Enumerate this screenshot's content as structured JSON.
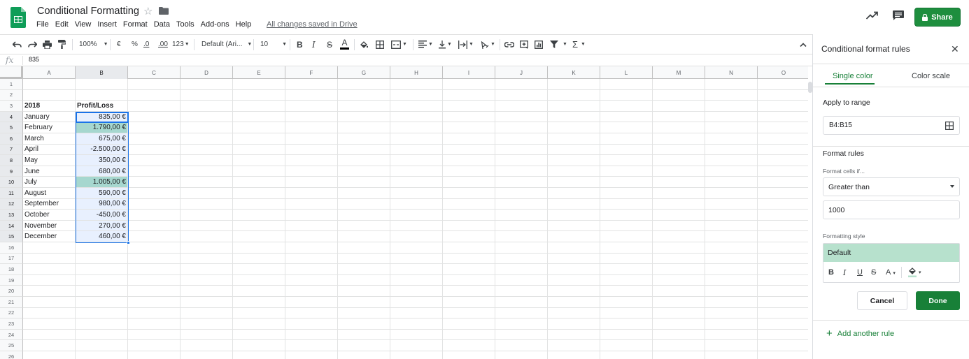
{
  "header": {
    "title": "Conditional Formatting",
    "saved_status": "All changes saved in Drive",
    "share_label": "Share",
    "menu": [
      "File",
      "Edit",
      "View",
      "Insert",
      "Format",
      "Data",
      "Tools",
      "Add-ons",
      "Help"
    ]
  },
  "toolbar": {
    "zoom": "100%",
    "currency": "€",
    "percent": "%",
    "dec_decrease": ".0",
    "dec_increase": ".00",
    "more_formats": "123",
    "font": "Default (Ari...",
    "font_size": "10",
    "bold": "B",
    "italic": "I",
    "strike": "S",
    "text_color": "A",
    "sum": "Σ"
  },
  "formula_bar": {
    "fx_label": "fx",
    "value": "835"
  },
  "grid": {
    "columns": [
      "A",
      "B",
      "C",
      "D",
      "E",
      "F",
      "G",
      "H",
      "I",
      "J",
      "K",
      "L",
      "M",
      "N",
      "O"
    ],
    "selected_column": "B",
    "row_count": 26,
    "cells": [
      {
        "row": 3,
        "col": "A",
        "text": "2018",
        "bold": true
      },
      {
        "row": 3,
        "col": "B",
        "text": "Profit/Loss",
        "bold": true
      },
      {
        "row": 4,
        "col": "A",
        "text": "January"
      },
      {
        "row": 4,
        "col": "B",
        "text": "835,00 €",
        "num": true
      },
      {
        "row": 5,
        "col": "A",
        "text": "February"
      },
      {
        "row": 5,
        "col": "B",
        "text": "1.790,00 €",
        "num": true,
        "hl": true
      },
      {
        "row": 6,
        "col": "A",
        "text": "March"
      },
      {
        "row": 6,
        "col": "B",
        "text": "675,00 €",
        "num": true
      },
      {
        "row": 7,
        "col": "A",
        "text": "April"
      },
      {
        "row": 7,
        "col": "B",
        "text": "-2.500,00 €",
        "num": true
      },
      {
        "row": 8,
        "col": "A",
        "text": "May"
      },
      {
        "row": 8,
        "col": "B",
        "text": "350,00 €",
        "num": true
      },
      {
        "row": 9,
        "col": "A",
        "text": "June"
      },
      {
        "row": 9,
        "col": "B",
        "text": "680,00 €",
        "num": true
      },
      {
        "row": 10,
        "col": "A",
        "text": "July"
      },
      {
        "row": 10,
        "col": "B",
        "text": "1.005,00 €",
        "num": true,
        "hl": true
      },
      {
        "row": 11,
        "col": "A",
        "text": "August"
      },
      {
        "row": 11,
        "col": "B",
        "text": "590,00 €",
        "num": true
      },
      {
        "row": 12,
        "col": "A",
        "text": "September"
      },
      {
        "row": 12,
        "col": "B",
        "text": "980,00 €",
        "num": true
      },
      {
        "row": 13,
        "col": "A",
        "text": "October"
      },
      {
        "row": 13,
        "col": "B",
        "text": "-450,00 €",
        "num": true
      },
      {
        "row": 14,
        "col": "A",
        "text": "November"
      },
      {
        "row": 14,
        "col": "B",
        "text": "270,00 €",
        "num": true
      },
      {
        "row": 15,
        "col": "A",
        "text": "December"
      },
      {
        "row": 15,
        "col": "B",
        "text": "460,00 €",
        "num": true
      }
    ]
  },
  "panel": {
    "title": "Conditional format rules",
    "tab_single": "Single color",
    "tab_scale": "Color scale",
    "apply_label": "Apply to range",
    "range": "B4:B15",
    "rules_label": "Format rules",
    "cells_if_label": "Format cells if...",
    "condition": "Greater than",
    "value": "1000",
    "style_label": "Formatting style",
    "style_preview": "Default",
    "style_tools": {
      "bold": "B",
      "italic": "I",
      "underline": "U",
      "strike": "S",
      "text_color": "A"
    },
    "cancel_label": "Cancel",
    "done_label": "Done",
    "add_rule_label": "Add another rule"
  },
  "colors": {
    "share_green": "#1e8e3e",
    "highlight": "#a6d7cf",
    "style_preview_bg": "#b7e1cd",
    "selection_blue": "#1a73e8"
  }
}
